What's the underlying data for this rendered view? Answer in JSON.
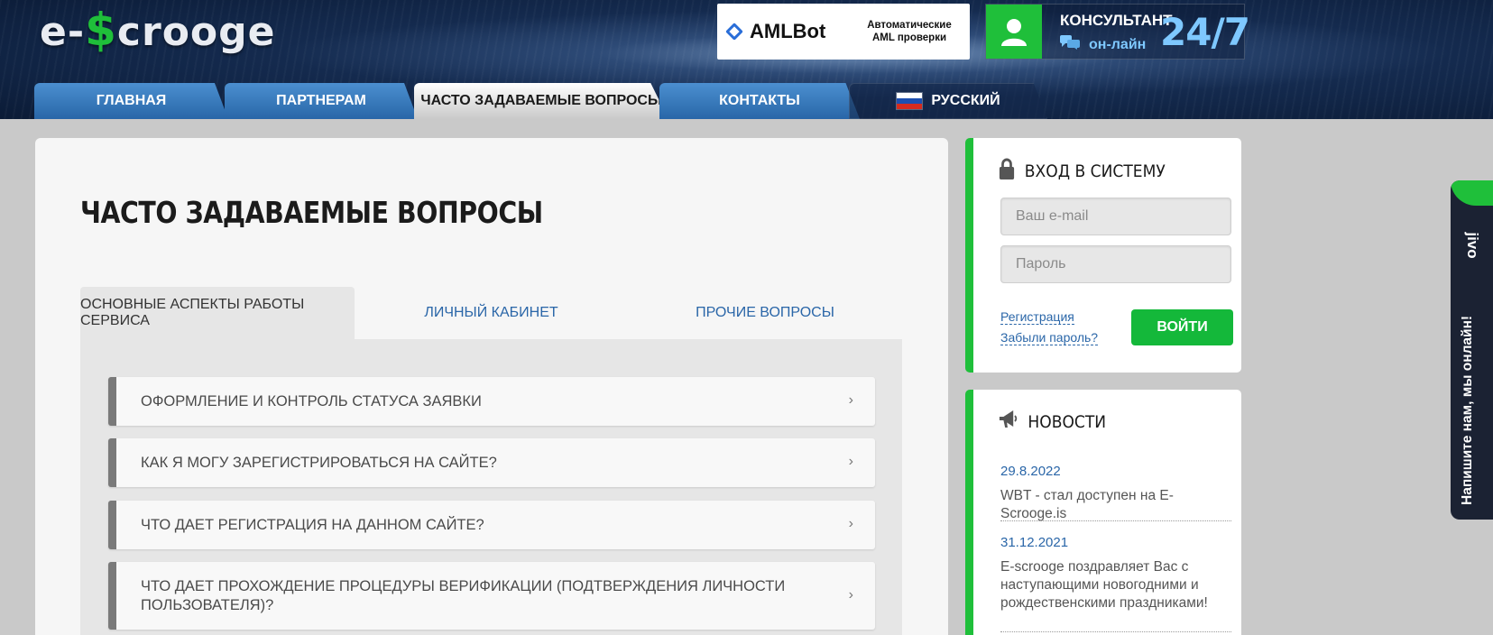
{
  "header": {
    "logo_prefix": "e-",
    "logo_dollar": "$",
    "logo_suffix": "crooge",
    "aml_name": "AMLBot",
    "aml_tagline_1": "Автоматические",
    "aml_tagline_2": "AML проверки",
    "consultant_title": "КОНСУЛЬТАНТ",
    "consultant_status": "он-лайн",
    "consultant_hours": "24/7"
  },
  "nav": {
    "items": [
      {
        "label": "Главная"
      },
      {
        "label": "Партнерам"
      },
      {
        "label": "Часто задаваемые вопросы"
      },
      {
        "label": "Контакты"
      },
      {
        "label": "Русский"
      }
    ]
  },
  "main": {
    "title": "ЧАСТО ЗАДАВАЕМЫЕ ВОПРОСЫ",
    "tabs": [
      {
        "label": "Основные аспекты работы сервиса"
      },
      {
        "label": "Личный кабинет"
      },
      {
        "label": "Прочие вопросы"
      }
    ],
    "faq": [
      {
        "question": "Оформление и контроль статуса заявки"
      },
      {
        "question": "Как я могу зарегистрироваться на сайте?"
      },
      {
        "question": "Что дает регистрация на данном сайте?"
      },
      {
        "question": "Что дает прохождение процедуры верификации (подтверждения личности пользователя)?"
      }
    ],
    "chevron": "›"
  },
  "login": {
    "title": "Вход в систему",
    "email_placeholder": "Ваш e-mail",
    "password_placeholder": "Пароль",
    "register_link": "Регистрация",
    "forgot_link": "Забыли пароль?",
    "submit_label": "Войти"
  },
  "news": {
    "title": "Новости",
    "items": [
      {
        "date": "29.8.2022",
        "text": "WBT - стал доступен на E-Scrooge.is"
      },
      {
        "date": "31.12.2021",
        "text": "E-scrooge поздравляет Вас с наступающими новогодними и рождественскими праздниками!"
      }
    ]
  },
  "jivo": {
    "brand": "jivo",
    "prompt": "Напишите нам, мы онлайн!"
  },
  "colors": {
    "accent_green": "#1fbf3a",
    "link_blue": "#2a66a8",
    "nav_blue": "#2866a8"
  }
}
